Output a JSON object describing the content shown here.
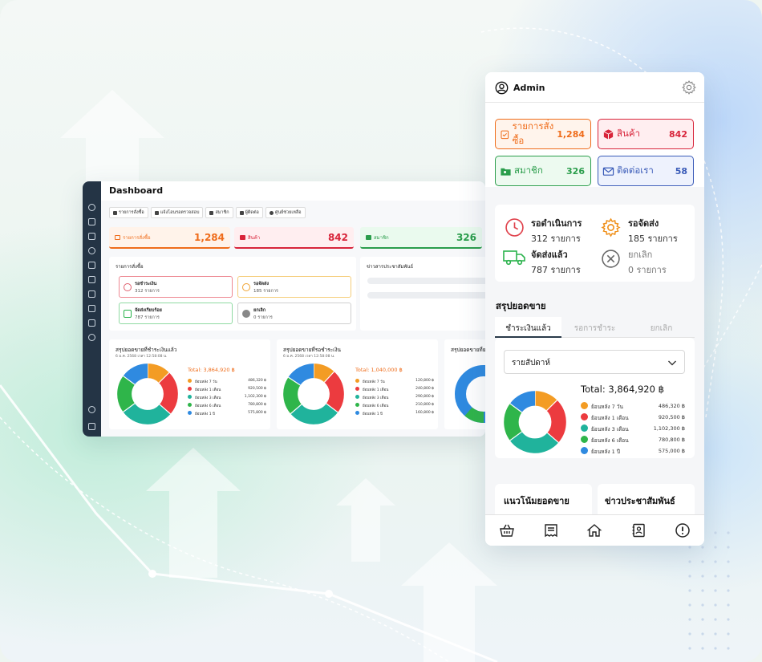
{
  "desktop": {
    "title": "Dashboard",
    "nav": [
      "รายการสั่งซื้อ",
      "แจ้งโอนรอตรวจสอบ",
      "สมาชิก",
      "ผู้ติดต่อ",
      "ศูนย์ช่วยเหลือ"
    ],
    "stats": [
      {
        "label": "รายการสั่งซื้อ",
        "value": "1,284",
        "color": "#ef6c1a"
      },
      {
        "label": "สินค้า",
        "value": "842",
        "color": "#d8243a"
      },
      {
        "label": "สมาชิก",
        "value": "326",
        "color": "#2a9d4b"
      }
    ],
    "orders_title": "รายการสั่งซื้อ",
    "orders": [
      {
        "name": "รอชำระเงิน",
        "count": "312 รายการ",
        "color": "#e0606e"
      },
      {
        "name": "รอจัดส่ง",
        "count": "185 รายการ",
        "color": "#f0a330"
      },
      {
        "name": "จัดส่งเรียบร้อย",
        "count": "787 รายการ",
        "color": "#2ab24c"
      },
      {
        "name": "ยกเลิก",
        "count": "0 รายการ",
        "color": "#888888"
      }
    ],
    "news_title": "ข่าวสารประชาสัมพันธ์",
    "pie_cards": [
      {
        "title": "สรุปยอดขายที่ชำระเงินแล้ว",
        "subtitle": "6 ม.ค. 2568 เวลา 12:58:08 น.",
        "total_label": "Total:",
        "total_value": "3,864,920 ฿",
        "legend": [
          {
            "name": "ย้อนหลัง 7 วัน",
            "value": "486,320 ฿"
          },
          {
            "name": "ย้อนหลัง 1 เดือน",
            "value": "920,500 ฿"
          },
          {
            "name": "ย้อนหลัง 3 เดือน",
            "value": "1,102,300 ฿"
          },
          {
            "name": "ย้อนหลัง 6 เดือน",
            "value": "780,800 ฿"
          },
          {
            "name": "ย้อนหลัง 1 ปี",
            "value": "575,800 ฿"
          }
        ]
      },
      {
        "title": "สรุปยอดขายที่รอชำระเงิน",
        "subtitle": "6 ม.ค. 2568 เวลา 12:58:08 น.",
        "total_label": "Total:",
        "total_value": "1,040,000 ฿",
        "legend": [
          {
            "name": "ย้อนหลัง 7 วัน",
            "value": "120,800 ฿"
          },
          {
            "name": "ย้อนหลัง 1 เดือน",
            "value": "240,800 ฿"
          },
          {
            "name": "ย้อนหลัง 3 เดือน",
            "value": "290,800 ฿"
          },
          {
            "name": "ย้อนหลัง 6 เดือน",
            "value": "210,800 ฿"
          },
          {
            "name": "ย้อนหลัง 1 ปี",
            "value": "160,800 ฿"
          }
        ]
      },
      {
        "title": "สรุปยอดขายที่ย"
      }
    ]
  },
  "mobile": {
    "user": "Admin",
    "stats": [
      {
        "label": "รายการสั่งซื้อ",
        "value": "1,284",
        "color": "#ef6c1a",
        "bg": "#fff4ec"
      },
      {
        "label": "สินค้า",
        "value": "842",
        "color": "#d8243a",
        "bg": "#ffeef0"
      },
      {
        "label": "สมาชิก",
        "value": "326",
        "color": "#2a9d4b",
        "bg": "#edfaf0"
      },
      {
        "label": "ติดต่อเรา",
        "value": "58",
        "color": "#3a5bb8",
        "bg": "#eef2fd"
      }
    ],
    "status": [
      {
        "name": "รอดำเนินการ",
        "count": "312 รายการ"
      },
      {
        "name": "รอจัดส่ง",
        "count": "185 รายการ"
      },
      {
        "name": "จัดส่งแล้ว",
        "count": "787 รายการ"
      },
      {
        "name": "ยกเลิก",
        "count": "0 รายการ"
      }
    ],
    "sales_title": "สรุปยอดขาย",
    "tabs": [
      "ชำระเงินแล้ว",
      "รอการชำระ",
      "ยกเลิก"
    ],
    "select_value": "รายสัปดาห์",
    "total_label": "Total: 3,864,920 ฿",
    "legend": [
      {
        "name": "ย้อนหลัง 7 วัน",
        "value": "486,320 ฿"
      },
      {
        "name": "ย้อนหลัง 1 เดือน",
        "value": "920,500 ฿"
      },
      {
        "name": "ย้อนหลัง 3 เดือน",
        "value": "1,102,300 ฿"
      },
      {
        "name": "ย้อนหลัง 6 เดือน",
        "value": "780,800 ฿"
      },
      {
        "name": "ย้อนหลัง 1 ปี",
        "value": "575,000 ฿"
      }
    ],
    "trend_title": "แนวโน้มยอดขาย",
    "news_title": "ข่าวประชาสัมพันธ์",
    "bottom_nav": [
      "basket-icon",
      "receipt-icon",
      "home-icon",
      "contacts-icon",
      "info-icon"
    ]
  },
  "colors": {
    "legend": [
      "#f39c24",
      "#ec3b3f",
      "#20b39c",
      "#2fb54a",
      "#2f8ae0"
    ],
    "sidebar": "#243445"
  }
}
